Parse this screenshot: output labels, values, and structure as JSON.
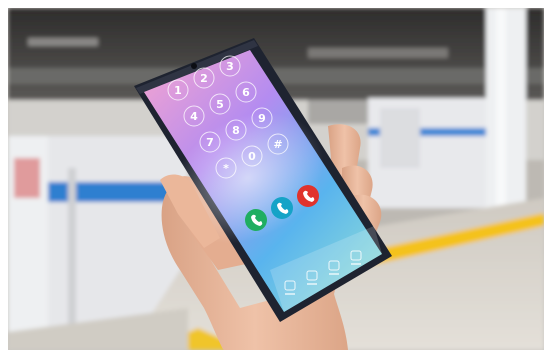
{
  "scene": {
    "subject": "hand holding smartphone on subway platform",
    "colors": {
      "ceiling": "#3a3938",
      "platform_wall": "#d8d6d2",
      "screen_door": "#e9eaec",
      "screen_door_stripe": "#2f7fd0",
      "tactile_paving": "#f4c21a",
      "floor": "#d7d3cb",
      "pillar": "#eceef0",
      "phone_body": "#1e2330",
      "skin": "#e8b79c"
    }
  },
  "phone": {
    "screen_gradient": [
      "#f7a5cf",
      "#9f87f0",
      "#54b7ee",
      "#8fe4d6"
    ],
    "keypad_digits": [
      "1",
      "2",
      "3",
      "4",
      "5",
      "6",
      "7",
      "8",
      "9",
      "*",
      "0",
      "#"
    ],
    "call_buttons": [
      {
        "icon": "phone-answer-icon",
        "color": "#1fae61"
      },
      {
        "icon": "phone-video-icon",
        "color": "#15a3c7"
      },
      {
        "icon": "phone-hangup-icon",
        "color": "#e0332c"
      }
    ],
    "bottom_icons": [
      "message-icon",
      "clock-icon",
      "contact-icon",
      "settings-icon"
    ]
  }
}
